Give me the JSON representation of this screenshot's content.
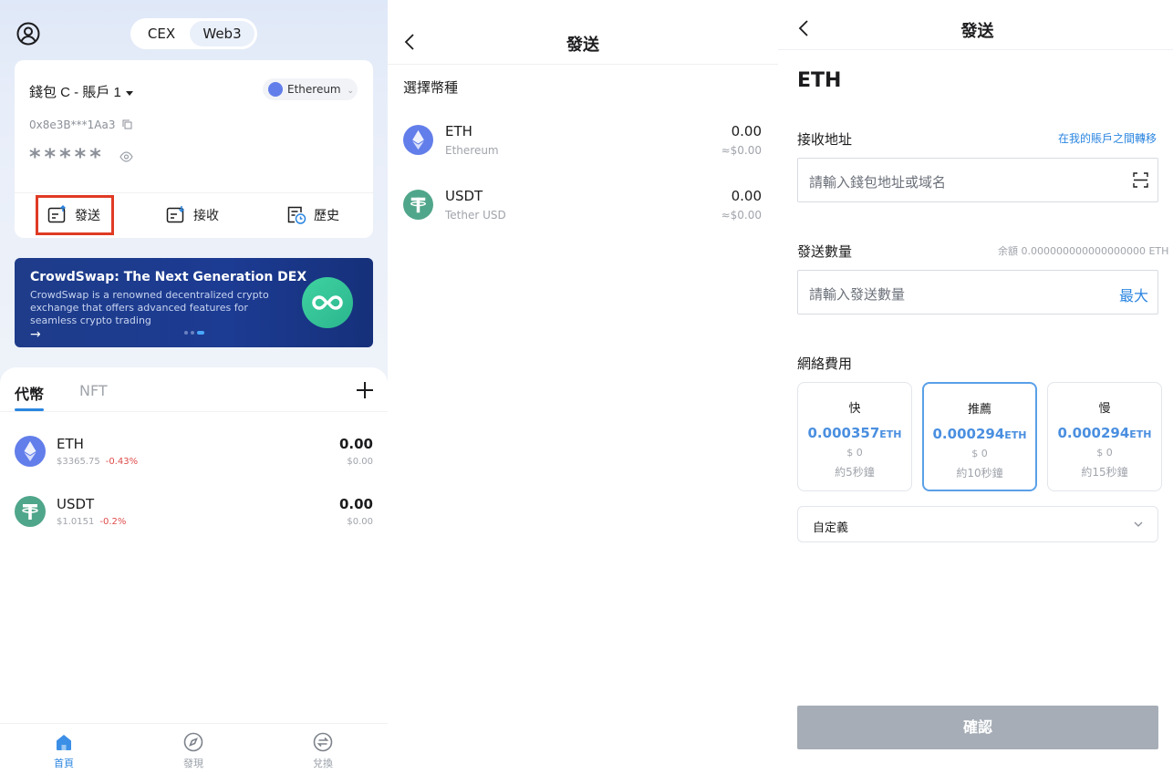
{
  "home": {
    "segment": {
      "cex": "CEX",
      "web3": "Web3"
    },
    "wallet_name": "錢包 C - 賬戶 1",
    "chain": "Ethereum",
    "address": "0x8e3B***1Aa3",
    "balance_masked": "*****",
    "actions": {
      "send": "發送",
      "receive": "接收",
      "history": "歷史"
    },
    "banner": {
      "title": "CrowdSwap: The Next Generation DEX",
      "desc": "CrowdSwap is a renowned decentralized crypto exchange that offers advanced features for seamless crypto trading",
      "arrow": "→"
    },
    "tabs": {
      "tokens": "代幣",
      "nft": "NFT"
    },
    "tokens": [
      {
        "symbol": "ETH",
        "price": "$3365.75",
        "change": "-0.43%",
        "amount": "0.00",
        "usd": "$0.00"
      },
      {
        "symbol": "USDT",
        "price": "$1.0151",
        "change": "-0.2%",
        "amount": "0.00",
        "usd": "$0.00"
      }
    ],
    "nav": {
      "home": "首頁",
      "discover": "發現",
      "swap": "兌換"
    }
  },
  "select": {
    "title": "發送",
    "section": "選擇幣種",
    "coins": [
      {
        "symbol": "ETH",
        "name": "Ethereum",
        "amount": "0.00",
        "usd": "≈$0.00"
      },
      {
        "symbol": "USDT",
        "name": "Tether USD",
        "amount": "0.00",
        "usd": "≈$0.00"
      }
    ]
  },
  "send": {
    "title": "發送",
    "asset": "ETH",
    "recipient_label": "接收地址",
    "transfer_link": "在我的賬戶之間轉移",
    "recipient_placeholder": "請輸入錢包地址或域名",
    "amount_label": "發送數量",
    "balance": "余額 0.000000000000000000 ETH",
    "amount_placeholder": "請輸入發送數量",
    "max": "最大",
    "fee_label": "網絡費用",
    "fees": [
      {
        "name": "快",
        "value": "0.000357",
        "unit": "ETH",
        "usd": "$ 0",
        "time": "約5秒鐘"
      },
      {
        "name": "推薦",
        "value": "0.000294",
        "unit": "ETH",
        "usd": "$ 0",
        "time": "約10秒鐘"
      },
      {
        "name": "慢",
        "value": "0.000294",
        "unit": "ETH",
        "usd": "$ 0",
        "time": "約15秒鐘"
      }
    ],
    "custom": "自定義",
    "confirm": "確認"
  },
  "colors": {
    "accent": "#2b86e0",
    "highlight": "#e03a24",
    "eth": "#627eea",
    "usdt": "#50a68a"
  }
}
